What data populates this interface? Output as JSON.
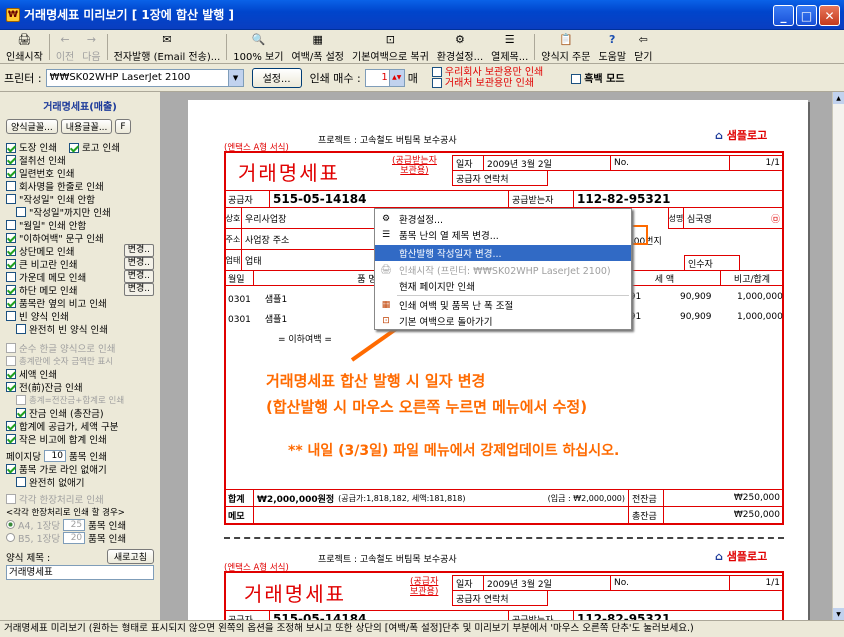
{
  "window": {
    "title": "거래명세표 미리보기 [ 1장에 합산 발행 ]",
    "icon": "app-icon"
  },
  "toolbar": {
    "buttons": [
      {
        "label": "인쇄시작",
        "icon": "printer-icon",
        "enabled": true
      },
      {
        "label": "이전",
        "icon": "arrow-left-icon",
        "enabled": false
      },
      {
        "label": "다음",
        "icon": "arrow-right-icon",
        "enabled": false
      },
      {
        "label": "전자발행 (Email 전송)...",
        "icon": "email-icon",
        "enabled": true
      },
      {
        "label": "100% 보기",
        "icon": "zoom-icon",
        "enabled": true
      },
      {
        "label": "여백/폭 설정",
        "icon": "margin-icon",
        "enabled": true
      },
      {
        "label": "기본여백으로 복귀",
        "icon": "reset-margin-icon",
        "enabled": true
      },
      {
        "label": "환경설정...",
        "icon": "settings-icon",
        "enabled": true
      },
      {
        "label": "열제목...",
        "icon": "column-title-icon",
        "enabled": true
      },
      {
        "label": "양식지 주문",
        "icon": "form-order-icon",
        "enabled": true
      },
      {
        "label": "도움말",
        "icon": "help-icon",
        "enabled": true
      },
      {
        "label": "닫기",
        "icon": "close-door-icon",
        "enabled": true
      }
    ]
  },
  "printbar": {
    "printer_label": "프린터 :",
    "printer_value": "₩₩SK02WHP LaserJet 2100",
    "settings_button": "설정...",
    "copies_label": "인쇄 매수 :",
    "copies_value": "1",
    "copies_unit": "매",
    "option1": "우리회사 보관용만 인쇄",
    "option2": "거래처 보관용만 인쇄",
    "bw_mode": "흑백 모드"
  },
  "sidebar": {
    "title": "거래명세표(매출)",
    "btn_form_font": "양식글꼴...",
    "btn_content_font": "내용글꼴...",
    "btn_f": "F",
    "row_stamp": "도장 인쇄",
    "row_logo": "로고 인쇄",
    "row_cutline": "절취선 인쇄",
    "row_serial": "일련번호 인쇄",
    "row_company_oneline": "회사명을 한줄로 인쇄",
    "row_writer": "\"작성일\" 인쇄 안함",
    "row_writer_sub": "\"작성일\"까지만 인쇄",
    "row_month": "\"월일\" 인쇄 안함",
    "row_below": "\"이하여백\" 문구 인쇄",
    "row_top_memo": "상단메모 인쇄",
    "row_big_remark": "큰 비고란 인쇄",
    "row_mid_memo": "가운데 메모 인쇄",
    "row_bottom_memo": "하단 메모 인쇄",
    "row_side_remark": "품목란 옆의 비고 인쇄",
    "row_empty_form": "빈 양식 인쇄",
    "row_empty_full": "완전히 빈 양식 인쇄",
    "btn_change": "변경..",
    "row_pure_amount": "순수 한글 양식으로 인쇄",
    "row_total_korean": "총계란에 숫자 금액만 표시",
    "row_tax": "세액 인쇄",
    "row_prev_balance": "전(前)잔금 인쇄",
    "row_prev_sub": "총계=전잔금+합계로 인쇄",
    "row_balance": "잔금 인쇄 (총잔금)",
    "row_supply_tax": "합계에 공급가, 세액 구분",
    "row_small_remark": "작은 비고에 합계 인쇄",
    "row_per_page_label": "페이지당",
    "row_per_page_value": "10",
    "row_per_page_unit": "품목 인쇄",
    "row_no_hline": "품목 가로 라인 없애기",
    "row_no_hline_sub": "완전히 없애기",
    "row_each_cut": "각각 한장처리로 인쇄",
    "row_case_label": "<각각 한장처리로 인쇄 할 경우>",
    "row_a4": "A4, 1장당",
    "row_a4_value": "25",
    "row_a4_unit": "품목 인쇄",
    "row_b5": "B5, 1장당",
    "row_b5_value": "20",
    "row_b5_unit": "품목 인쇄",
    "title_label": "양식 제목 :",
    "refresh_button": "새로고침",
    "title_value": "거래명세표"
  },
  "document": {
    "form_type": "(엔택스 A형 서식)",
    "project": "프로젝트 : 고속철도 버팀목 보수공사",
    "logo_text": "샘플로고",
    "title": "거래명세표",
    "recipient_copy": "(공급받는자\n보관용)",
    "supplier_copy": "(공급자\n보관용)",
    "date_label": "일자",
    "date_value": "2009년 3월 2일",
    "no_label": "No.",
    "page_value": "1/1",
    "receiver_contact": "공급자 연락처",
    "supplier_label": "공급자",
    "supplier_no": "515-05-14184",
    "receiver_label": "공급받는자",
    "receiver_no": "112-82-95321",
    "company_label": "상호",
    "company_value": "우리사업장",
    "name_label": "성명",
    "name_value": "심국영",
    "address_label": "주소",
    "address_value": "사업장 주소",
    "address_tail": "400번지",
    "business_label": "업태",
    "business_value": "업태",
    "acceptor_label": "인수자",
    "col_month": "월일",
    "col_item": "품 명 / 규 격",
    "col_tax": "세 액",
    "col_total": "비고/합계",
    "rows": [
      {
        "date": "0301",
        "item": "샘플1",
        "code": "091",
        "tax": "90,909",
        "total": "1,000,000"
      },
      {
        "date": "0301",
        "item": "샘플1",
        "code": "091",
        "tax": "90,909",
        "total": "1,000,000"
      }
    ],
    "below_blank": "= 이하여백 =",
    "sum_label": "합계",
    "sum_value": "₩2,000,000원정",
    "sum_detail": "(공급가:1,818,182, 세액:181,818)",
    "sum_input": "(입금 : ₩2,000,000)",
    "prev_balance_label": "전잔금",
    "prev_balance_value": "₩250,000",
    "memo_label": "메모",
    "total_balance_label": "총잔금",
    "total_balance_value": "₩250,000"
  },
  "context_menu": {
    "items": [
      {
        "label": "환경설정...",
        "icon": "settings-icon",
        "state": "normal"
      },
      {
        "label": "품목 난의 열 제목 변경...",
        "icon": "column-title-icon",
        "state": "normal"
      },
      {
        "label": "합산발행 작성일자 변경...",
        "icon": "",
        "state": "highlighted"
      },
      {
        "label": "인쇄시작 (프린터: ₩₩SK02WHP LaserJet 2100)",
        "icon": "printer-icon",
        "state": "disabled"
      },
      {
        "label": "현재 페이지만 인쇄",
        "icon": "",
        "state": "normal"
      },
      {
        "label": "인쇄 여백 및 품목 난 폭 조절",
        "icon": "margin-icon",
        "state": "normal"
      },
      {
        "label": "기본 여백으로 돌아가기",
        "icon": "reset-margin-icon",
        "state": "normal"
      }
    ]
  },
  "annotation": {
    "line1": "거래명세표 합산 발행 시 일자 변경",
    "line2": "(합산발행 시 마우스 오른쪽 누르면 메뉴에서 수정)",
    "line3": "** 내일 (3/3일) 파일 메뉴에서 강제업데이트 하십시오.",
    "color": "#ff6a00"
  },
  "status": {
    "text": "거래명세표 미리보기 (원하는 형태로 표시되지 않으면 왼쪽의 옵션을 조정해 보시고 또한 상단의 [여백/폭 설정]단추 및 미리보기 부분에서 '마우스 오른쪽 단추'도 눌러보세요.)"
  }
}
